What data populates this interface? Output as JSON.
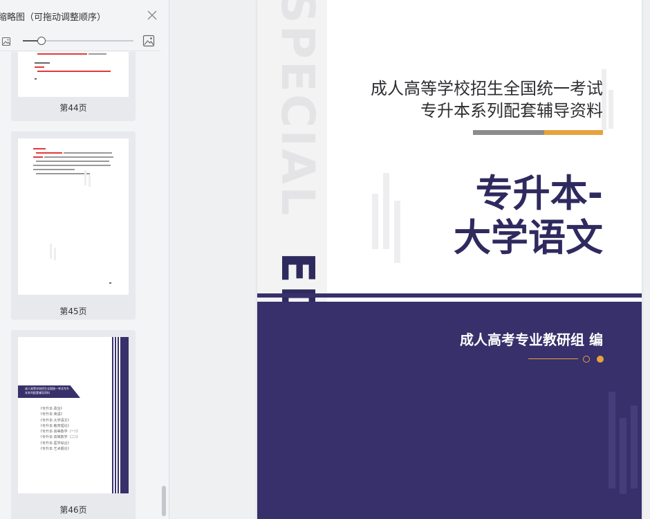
{
  "sidebar": {
    "title": "缩略图（可拖动调整顺序）",
    "zoom": {
      "level": 0.17
    },
    "thumbnails": [
      {
        "label": "第44页",
        "lines": [
          "“\u001f我是这样写的\u001f——”",
          "(2) 本一生成",
          "\"将 国内和 国外之间\""
        ]
      },
      {
        "label": "第45页",
        "lines": [
          "若要求，",
          "(1) “对与不 打了”",
          "本身也是"
        ]
      },
      {
        "label": "第46页",
        "banner": "成人高等学校招生全国统一考试专升本系列配套辅导资料",
        "list": [
          "《专升本·政治》",
          "《专升本·英语》",
          "《专升本·大学语文》",
          "《专升本·教育理论》",
          "《专升本·高等数学（一）》",
          "《专升本·高等数学（二）》",
          "《专升本·医学综合》",
          "《专升本·艺术概论》"
        ]
      }
    ]
  },
  "cover": {
    "watermark_top": "SPECIAL",
    "watermark_bottom": "EDITION",
    "subtitle_line1": "成人高等学校招生全国统一考试",
    "subtitle_line2": "专升本系列配套辅导资料",
    "title_line1": "专升本-",
    "title_line2": "大学语文",
    "author": "成人高考专业教研组 编",
    "colors": {
      "primary": "#37306b",
      "accent": "#e7a23c",
      "gray": "#8c8c8c"
    }
  }
}
